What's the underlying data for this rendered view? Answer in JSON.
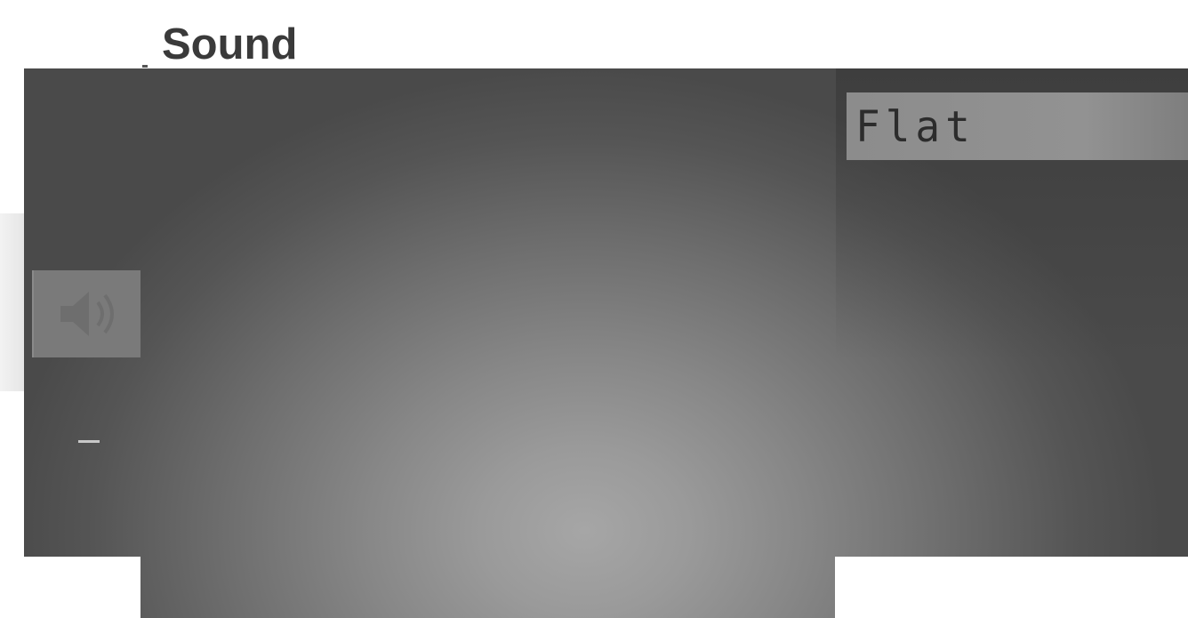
{
  "menu": {
    "title": "Sound"
  },
  "option": {
    "value": "Flat"
  },
  "icons": {
    "sound": "sound-speaker-icon"
  },
  "colors": {
    "panel_center": "#a6a6a6",
    "panel_edge": "#4a4a4a",
    "field_bg": "#8c8c8c",
    "title_text": "#3a3a3a"
  }
}
